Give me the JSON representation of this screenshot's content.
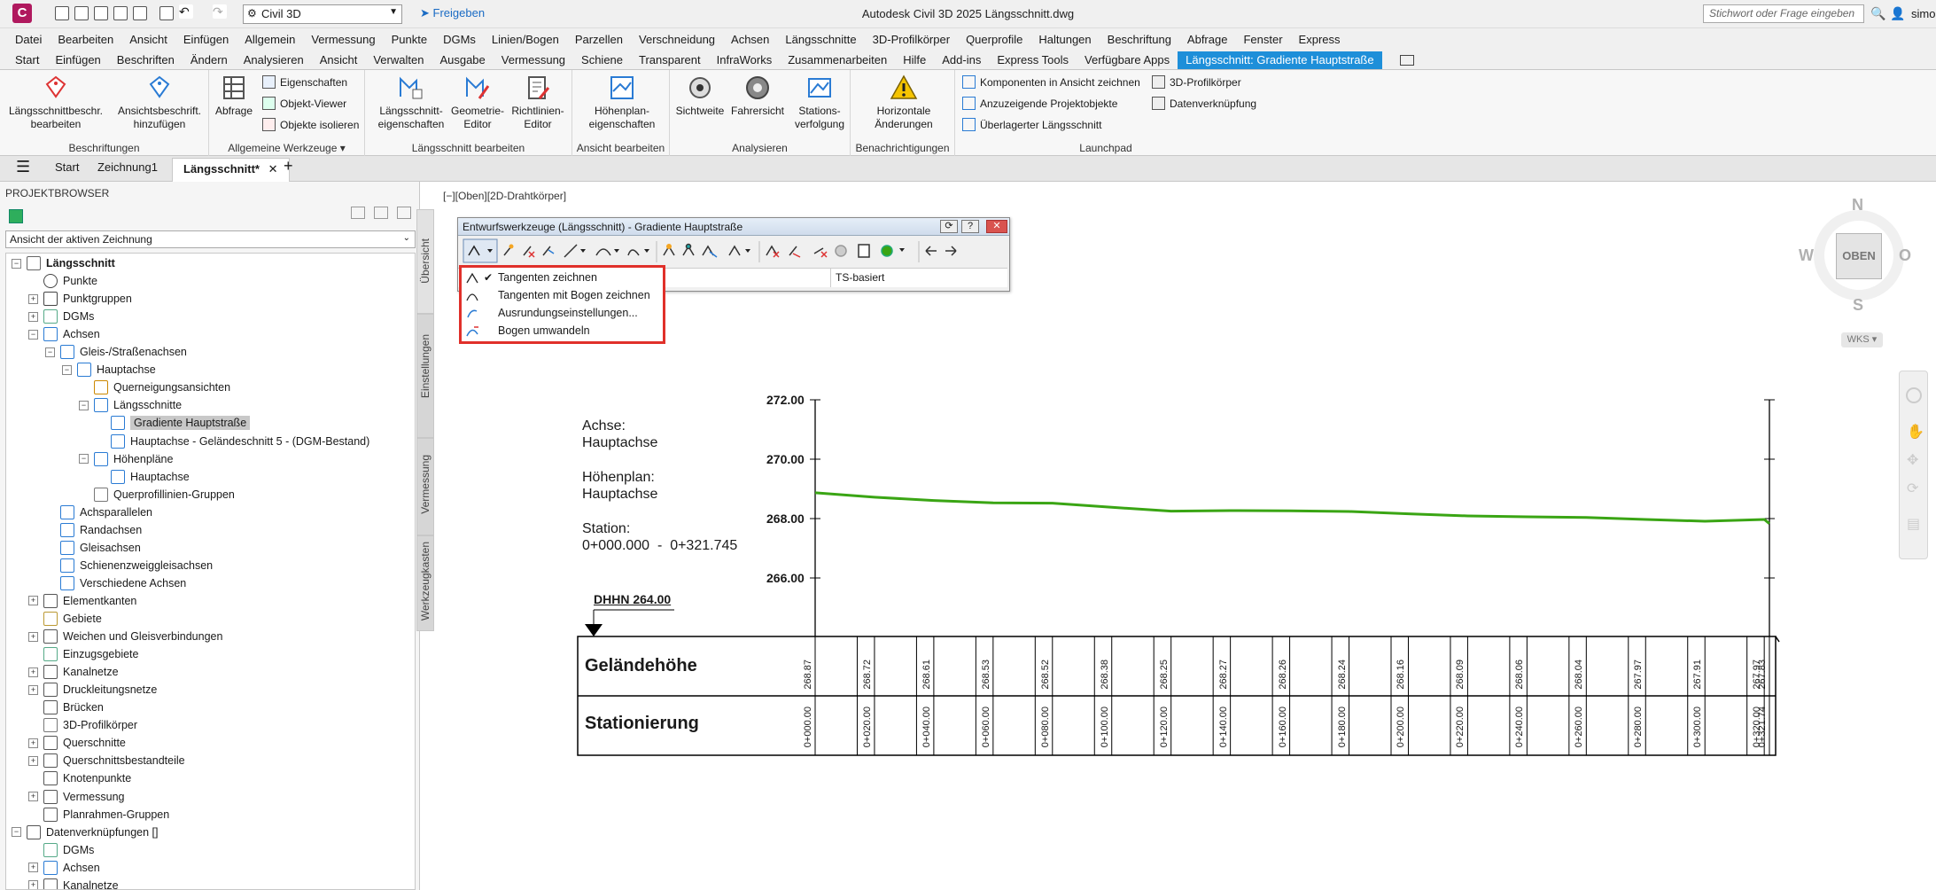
{
  "titlebar": {
    "workspace": "Civil 3D",
    "share_label": "Freigeben",
    "app_title": "Autodesk Civil 3D 2025    Längsschnitt.dwg",
    "search_placeholder": "Stichwort oder Frage eingeben",
    "user": "simon"
  },
  "menubar": [
    "Datei",
    "Bearbeiten",
    "Ansicht",
    "Einfügen",
    "Allgemein",
    "Vermessung",
    "Punkte",
    "DGMs",
    "Linien/Bogen",
    "Parzellen",
    "Verschneidung",
    "Achsen",
    "Längsschnitte",
    "3D-Profilkörper",
    "Querprofile",
    "Haltungen",
    "Beschriftung",
    "Abfrage",
    "Fenster",
    "Express"
  ],
  "ribbon_tabs": [
    "Start",
    "Einfügen",
    "Beschriften",
    "Ändern",
    "Analysieren",
    "Ansicht",
    "Verwalten",
    "Ausgabe",
    "Vermessung",
    "Schiene",
    "Transparent",
    "InfraWorks",
    "Zusammenarbeiten",
    "Hilfe",
    "Add-ins",
    "Express Tools",
    "Verfügbare Apps",
    "Längsschnitt: Gradiente Hauptstraße"
  ],
  "ribbon": {
    "panels": {
      "beschriftungen": "Beschriftungen",
      "allg_werkzeuge": "Allgemeine Werkzeuge",
      "ls_bearbeiten": "Längsschnitt bearbeiten",
      "ansicht_bearbeiten": "Ansicht bearbeiten",
      "analysieren": "Analysieren",
      "benachrichtigungen": "Benachrichtigungen",
      "launchpad": "Launchpad"
    },
    "btn_ls_beschr_1": "Längsschnittbeschr.",
    "btn_ls_beschr_2": "bearbeiten",
    "btn_ansichts_1": "Ansichtsbeschrift.",
    "btn_ansichts_2": "hinzufügen",
    "btn_abfrage": "Abfrage",
    "btn_eigenschaften": "Eigenschaften",
    "btn_objekt_viewer": "Objekt-Viewer",
    "btn_objekte_isolieren": "Objekte isolieren",
    "btn_ls_eig_1": "Längsschnitt-",
    "btn_ls_eig_2": "eigenschaften",
    "btn_geo_1": "Geometrie-",
    "btn_geo_2": "Editor",
    "btn_richt_1": "Richtlinien-",
    "btn_richt_2": "Editor",
    "btn_hp_1": "Höhenplan-",
    "btn_hp_2": "eigenschaften",
    "btn_sichtweite": "Sichtweite",
    "btn_fahrersicht": "Fahrersicht",
    "btn_stat_1": "Stations-",
    "btn_stat_2": "verfolgung",
    "btn_horiz_1": "Horizontale",
    "btn_horiz_2": "Änderungen",
    "btn_komp": "Komponenten in Ansicht zeichnen",
    "btn_anzeig": "Anzuzeigende Projektobjekte",
    "btn_ueberl": "Überlagerter Längsschnitt",
    "btn_3dpk": "3D-Profilkörper",
    "btn_datenv": "Datenverknüpfung"
  },
  "doc_tabs": {
    "start": "Start",
    "zeichnung": "Zeichnung1",
    "active": "Längsschnitt*"
  },
  "browser": {
    "title": "PROJEKTBROWSER",
    "scope": "Ansicht der aktiven Zeichnung",
    "side_tabs": [
      "Übersicht",
      "Einstellungen",
      "Vermessung",
      "Werkzeugkasten"
    ],
    "tree": {
      "n0": "Längsschnitt",
      "n1": "Punkte",
      "n2": "Punktgruppen",
      "n3": "DGMs",
      "n4": "Achsen",
      "n5": "Gleis-/Straßenachsen",
      "n6": "Hauptachse",
      "n7": "Querneigungsansichten",
      "n8": "Längsschnitte",
      "n9": "Gradiente Hauptstraße",
      "n10": "Hauptachse - Geländeschnitt 5 - (DGM-Bestand)",
      "n11": "Höhenpläne",
      "n12": "Hauptachse",
      "n13": "Querprofillinien-Gruppen",
      "n14": "Achsparallelen",
      "n15": "Randachsen",
      "n16": "Gleisachsen",
      "n17": "Schienenzweiggleisachsen",
      "n18": "Verschiedene Achsen",
      "n19": "Elementkanten",
      "n20": "Gebiete",
      "n21": "Weichen und Gleisverbindungen",
      "n22": "Einzugsgebiete",
      "n23": "Kanalnetze",
      "n24": "Druckleitungsnetze",
      "n25": "Brücken",
      "n26": "3D-Profilkörper",
      "n27": "Querschnitte",
      "n28": "Querschnittsbestandteile",
      "n29": "Knotenpunkte",
      "n30": "Vermessung",
      "n31": "Planrahmen-Gruppen",
      "n32": "Datenverknüpfungen []",
      "n33": "DGMs",
      "n34": "Achsen",
      "n35": "Kanalnetze"
    }
  },
  "viewport_label": "[−][Oben][2D-Drahtkörper]",
  "design_toolbar": {
    "title": "Entwurfswerkzeuge (Längsschnitt) - Gradiente Hauptstraße",
    "status_mode": "TS-basiert"
  },
  "dropdown": {
    "items": [
      "Tangenten zeichnen",
      "Tangenten mit Bogen zeichnen",
      "Ausrundungseinstellungen...",
      "Bogen umwandeln"
    ],
    "checked_index": 0
  },
  "profile": {
    "achse_label": "Achse:",
    "achse_value": "Hauptachse",
    "hoehenplan_label": "Höhenplan:",
    "hoehenplan_value": "Hauptachse",
    "station_label": "Station:",
    "station_range": "0+000.000  -  0+321.745",
    "datum": "DHHN 264.00",
    "elev_labels": [
      "272.00",
      "270.00",
      "268.00",
      "266.00"
    ],
    "band_gelaende": "Geländehöhe",
    "band_station": "Stationierung",
    "gelaende_values": [
      "268.87",
      "268.72",
      "268.61",
      "268.53",
      "268.52",
      "268.38",
      "268.25",
      "268.27",
      "268.26",
      "268.24",
      "268.16",
      "268.09",
      "268.06",
      "268.04",
      "267.97",
      "267.91",
      "267.97",
      "267.83"
    ],
    "station_values": [
      "0+000.00",
      "0+020.00",
      "0+040.00",
      "0+060.00",
      "0+080.00",
      "0+100.00",
      "0+120.00",
      "0+140.00",
      "0+160.00",
      "0+180.00",
      "0+200.00",
      "0+220.00",
      "0+240.00",
      "0+260.00",
      "0+280.00",
      "0+300.00",
      "0+320.00",
      "0+321.74"
    ],
    "line_color": "#3aa514"
  },
  "viewcube": {
    "n": "N",
    "s": "S",
    "w": "W",
    "o": "O",
    "face": "OBEN",
    "wks": "WKS"
  }
}
